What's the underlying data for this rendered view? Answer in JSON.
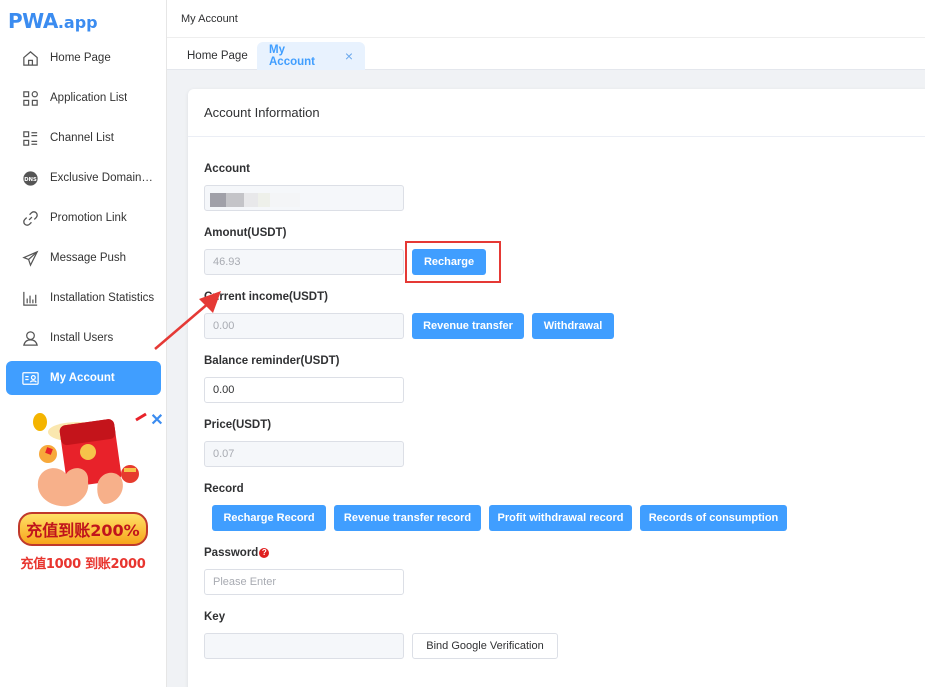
{
  "logo": {
    "main": "PWA",
    "suffix": ".app"
  },
  "sidebar": {
    "items": [
      {
        "label": "Home Page",
        "icon": "home-icon"
      },
      {
        "label": "Application List",
        "icon": "apps-grid-icon"
      },
      {
        "label": "Channel List",
        "icon": "channel-list-icon"
      },
      {
        "label": "Exclusive Domain Name",
        "icon": "dns-globe-icon"
      },
      {
        "label": "Promotion Link",
        "icon": "link-icon"
      },
      {
        "label": "Message Push",
        "icon": "paper-plane-icon"
      },
      {
        "label": "Installation Statistics",
        "icon": "bar-chart-icon"
      },
      {
        "label": "Install Users",
        "icon": "user-icon"
      },
      {
        "label": "My Account",
        "icon": "account-card-icon",
        "active": true
      }
    ]
  },
  "promo": {
    "headline": "充值到账200%",
    "subline": "充值1000 到账2000",
    "close": "✕"
  },
  "breadcrumb": "My Account",
  "tabs": [
    {
      "label": "Home Page"
    },
    {
      "label": "My Account",
      "close": "×",
      "active": true
    }
  ],
  "card": {
    "title": "Account Information",
    "account": {
      "label": "Account",
      "value": ""
    },
    "amount": {
      "label": "Amonut(USDT)",
      "value": "46.93",
      "recharge": "Recharge"
    },
    "income": {
      "label": "Current income(USDT)",
      "value": "0.00",
      "transfer": "Revenue transfer",
      "withdrawal": "Withdrawal"
    },
    "balance": {
      "label": "Balance reminder(USDT)",
      "value": "0.00"
    },
    "price": {
      "label": "Price(USDT)",
      "value": "0.07"
    },
    "record": {
      "label": "Record",
      "buttons": [
        "Recharge Record",
        "Revenue transfer record",
        "Profit withdrawal record",
        "Records of consumption"
      ]
    },
    "password": {
      "label": "Password",
      "required": "?",
      "placeholder": "Please Enter"
    },
    "key": {
      "label": "Key",
      "value": "",
      "bind": "Bind Google Verification"
    }
  },
  "colors": {
    "primary": "#409eff",
    "highlight": "#e53935",
    "logo": "#3b8cf0"
  }
}
